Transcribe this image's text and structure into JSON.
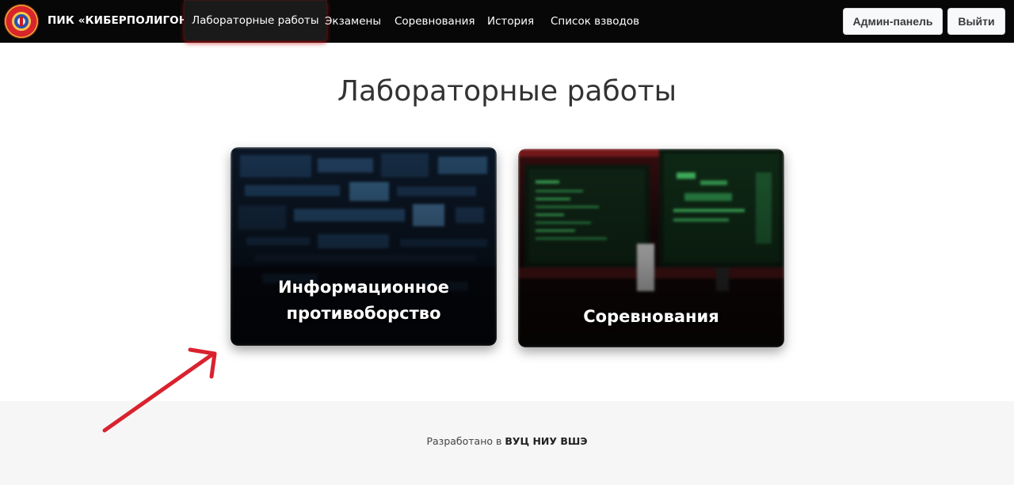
{
  "nav": {
    "brand": "ПИК «КИБЕРПОЛИГОН»",
    "items": [
      {
        "label": "Лабораторные работы",
        "active": true
      },
      {
        "label": "Экзамены"
      },
      {
        "label": "Соревнования"
      },
      {
        "label": "История"
      },
      {
        "label": "Список взводов"
      }
    ],
    "admin_button": "Админ-панель",
    "logout_button": "Выйти"
  },
  "main": {
    "title": "Лабораторные работы",
    "cards": [
      {
        "label_line1": "Информационное",
        "label_line2": "противоборство"
      },
      {
        "label": "Соревнования"
      }
    ]
  },
  "footer": {
    "prefix": "Разработано в ",
    "org": "ВУЦ НИУ ВШЭ"
  },
  "colors": {
    "navbar_bg": "#070707",
    "active_glow": "#c81414",
    "annotation_arrow": "#d9222e"
  }
}
